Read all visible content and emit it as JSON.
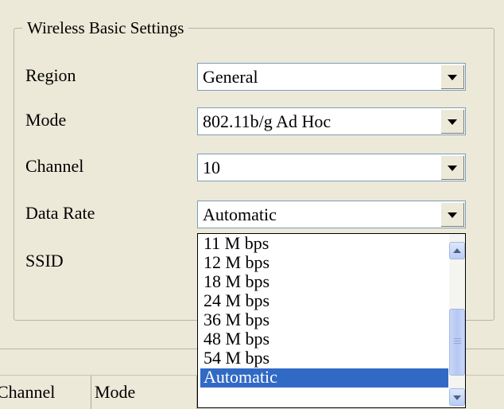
{
  "group": {
    "title": "Wireless Basic Settings"
  },
  "fields": {
    "region": {
      "label": "Region",
      "value": "General"
    },
    "mode": {
      "label": "Mode",
      "value": "802.11b/g Ad Hoc"
    },
    "channel": {
      "label": "Channel",
      "value": "10"
    },
    "data_rate": {
      "label": "Data Rate",
      "value": "Automatic"
    },
    "ssid": {
      "label": "SSID"
    }
  },
  "data_rate_options": [
    "11 M bps",
    "12 M bps",
    "18 M bps",
    "24 M bps",
    "36 M bps",
    "48 M bps",
    "54 M bps",
    "Automatic"
  ],
  "selected_option": "Automatic",
  "table": {
    "headers": [
      "Channel",
      "Mode"
    ]
  },
  "icons": {
    "dropdown_arrow": "chevron-down-icon",
    "scroll_up": "chevron-up-icon",
    "scroll_down": "chevron-down-icon"
  },
  "colors": {
    "selection": "#316ac5",
    "window": "#ece9d8"
  }
}
